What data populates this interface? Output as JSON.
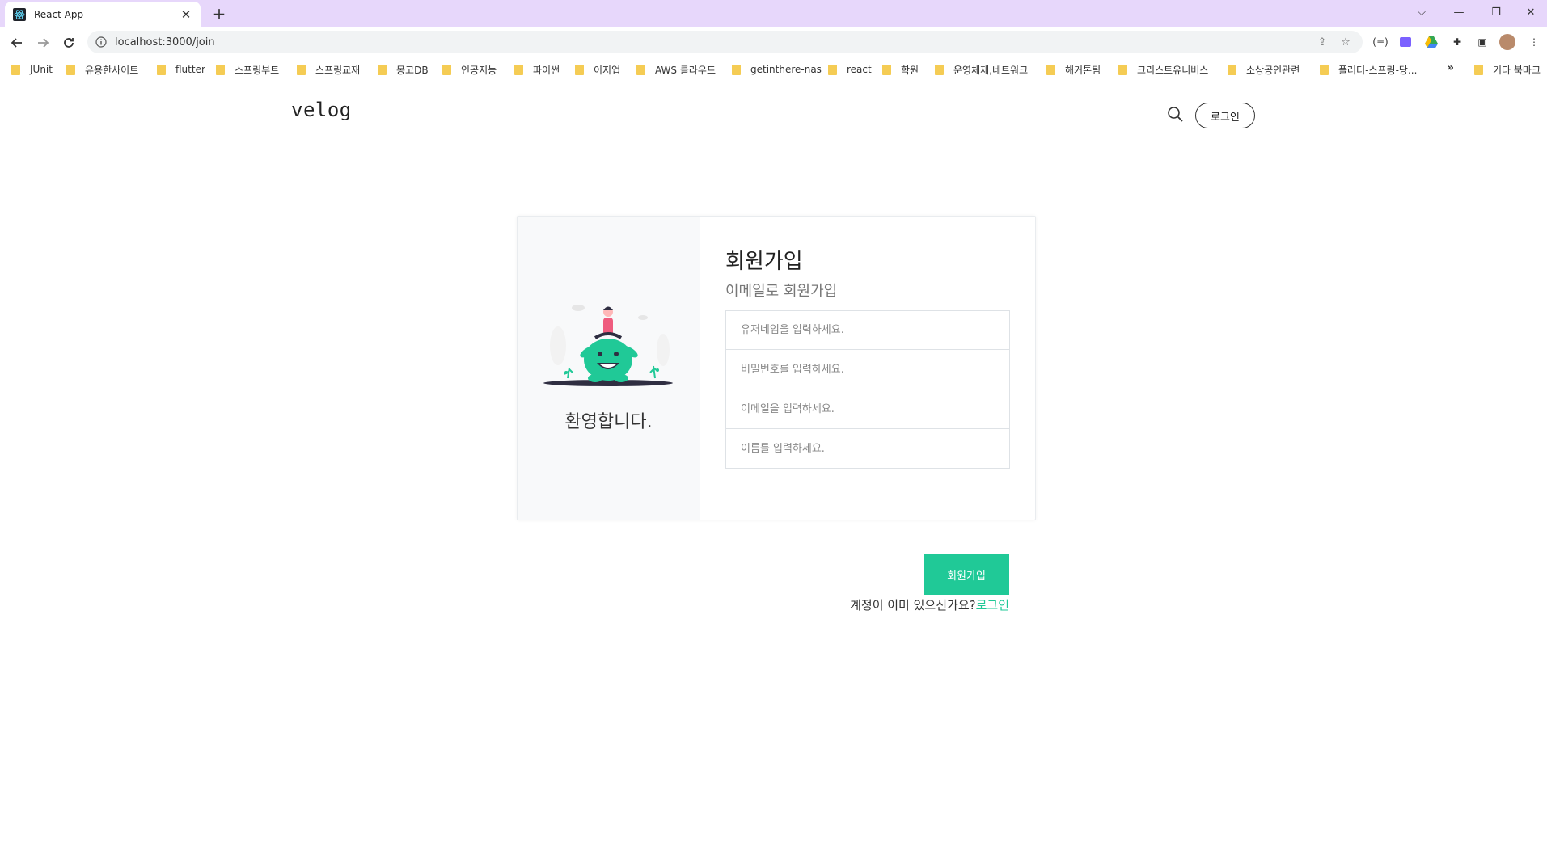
{
  "browser": {
    "tab_title": "React App",
    "url": "localhost:3000/join",
    "bookmarks": [
      "JUnit",
      "유용한사이트",
      "flutter",
      "스프링부트",
      "스프링교재",
      "몽고DB",
      "인공지능",
      "파이썬",
      "이지업",
      "AWS 클라우드",
      "getinthere-nas",
      "react",
      "학원",
      "운영체제,네트워크",
      "해커톤팀",
      "크리스트유니버스",
      "소상공인관련",
      "플러터-스프링-당...",
      "기타 북마크"
    ],
    "more_label": "»"
  },
  "header": {
    "logo": "velog",
    "login_label": "로그인"
  },
  "card": {
    "welcome": "환영합니다.",
    "title": "회원가입",
    "subtitle": "이메일로 회원가입",
    "inputs": {
      "username_placeholder": "유저네임을 입력하세요.",
      "password_placeholder": "비밀번호를 입력하세요.",
      "email_placeholder": "이메일을 입력하세요.",
      "name_placeholder": "이름를 입력하세요."
    },
    "submit_label": "회원가입",
    "footer_text": "계정이 이미 있으신가요?",
    "footer_link": "로그인"
  },
  "colors": {
    "accent": "#20c997",
    "tabbar": "#e7d7fb"
  }
}
